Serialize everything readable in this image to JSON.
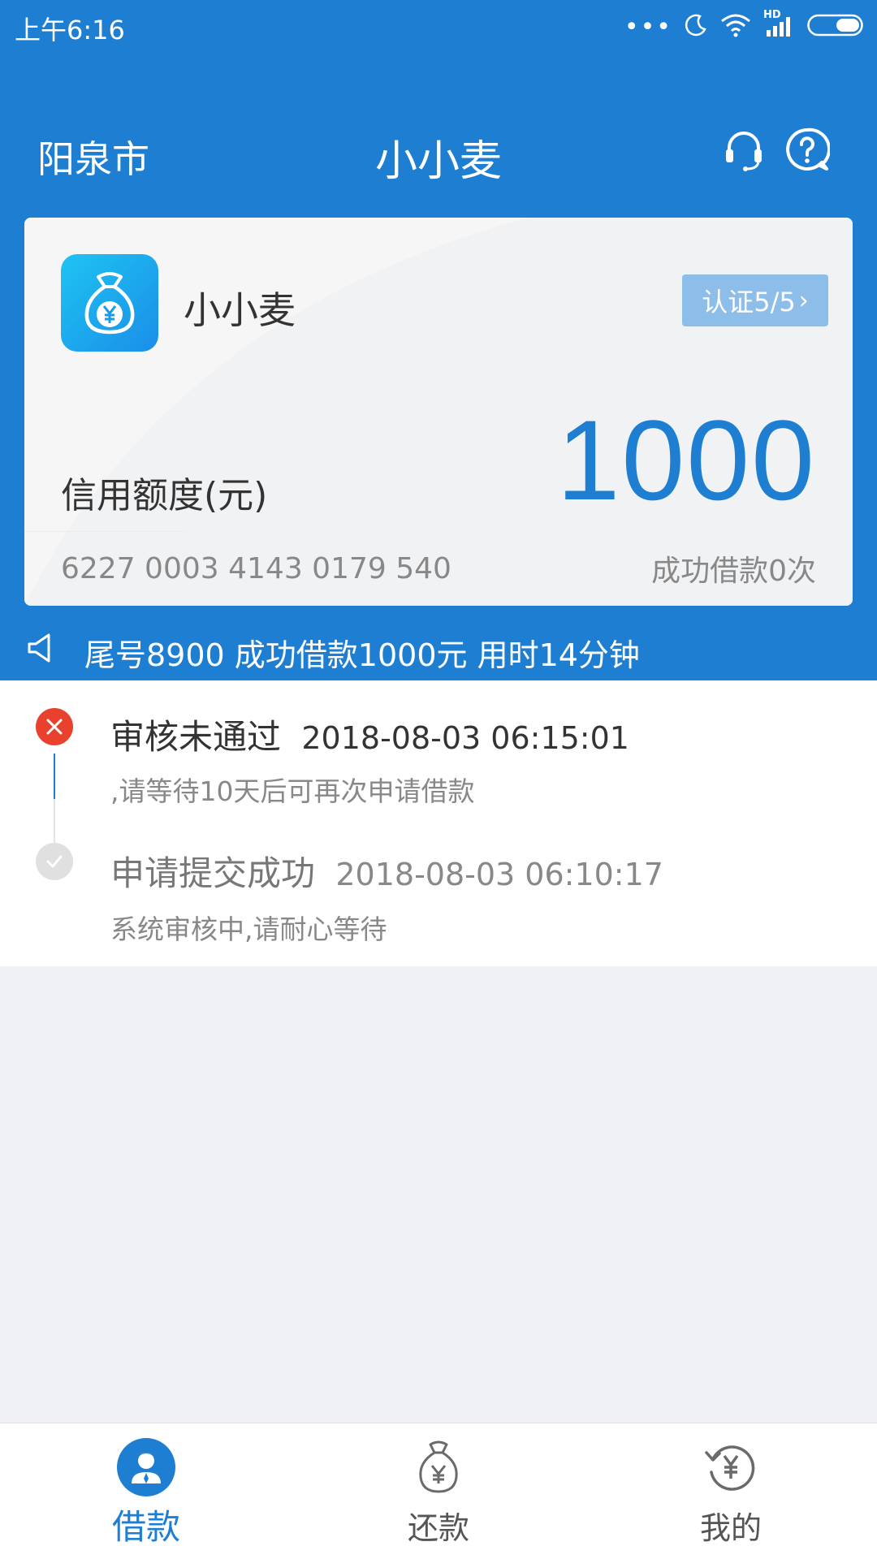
{
  "status_bar": {
    "time": "上午6:16",
    "dots": "•••",
    "network_label": "HD"
  },
  "nav": {
    "city": "阳泉市",
    "title": "小小麦"
  },
  "card": {
    "name": "小小麦",
    "certification": "认证5/5",
    "limit_label": "信用额度(元)",
    "amount": "1000",
    "card_number": "6227 0003 4143 0179 540",
    "success_count": "成功借款0次"
  },
  "notice": {
    "text": "尾号8900 成功借款1000元 用时14分钟"
  },
  "timeline": [
    {
      "title": "审核未通过",
      "time": "2018-08-03 06:15:01",
      "subtitle": ",请等待10天后可再次申请借款",
      "status": "failed"
    },
    {
      "title": "申请提交成功",
      "time": "2018-08-03 06:10:17",
      "subtitle": "系统审核中,请耐心等待",
      "status": "done"
    }
  ],
  "tabs": [
    {
      "label": "借款",
      "icon": "borrow-icon",
      "active": true
    },
    {
      "label": "还款",
      "icon": "repay-icon",
      "active": false
    },
    {
      "label": "我的",
      "icon": "profile-icon",
      "active": false
    }
  ],
  "colors": {
    "brand_blue": "#1e7fd2",
    "fail_red": "#e8422f",
    "page_bg": "#f0f1f5"
  }
}
